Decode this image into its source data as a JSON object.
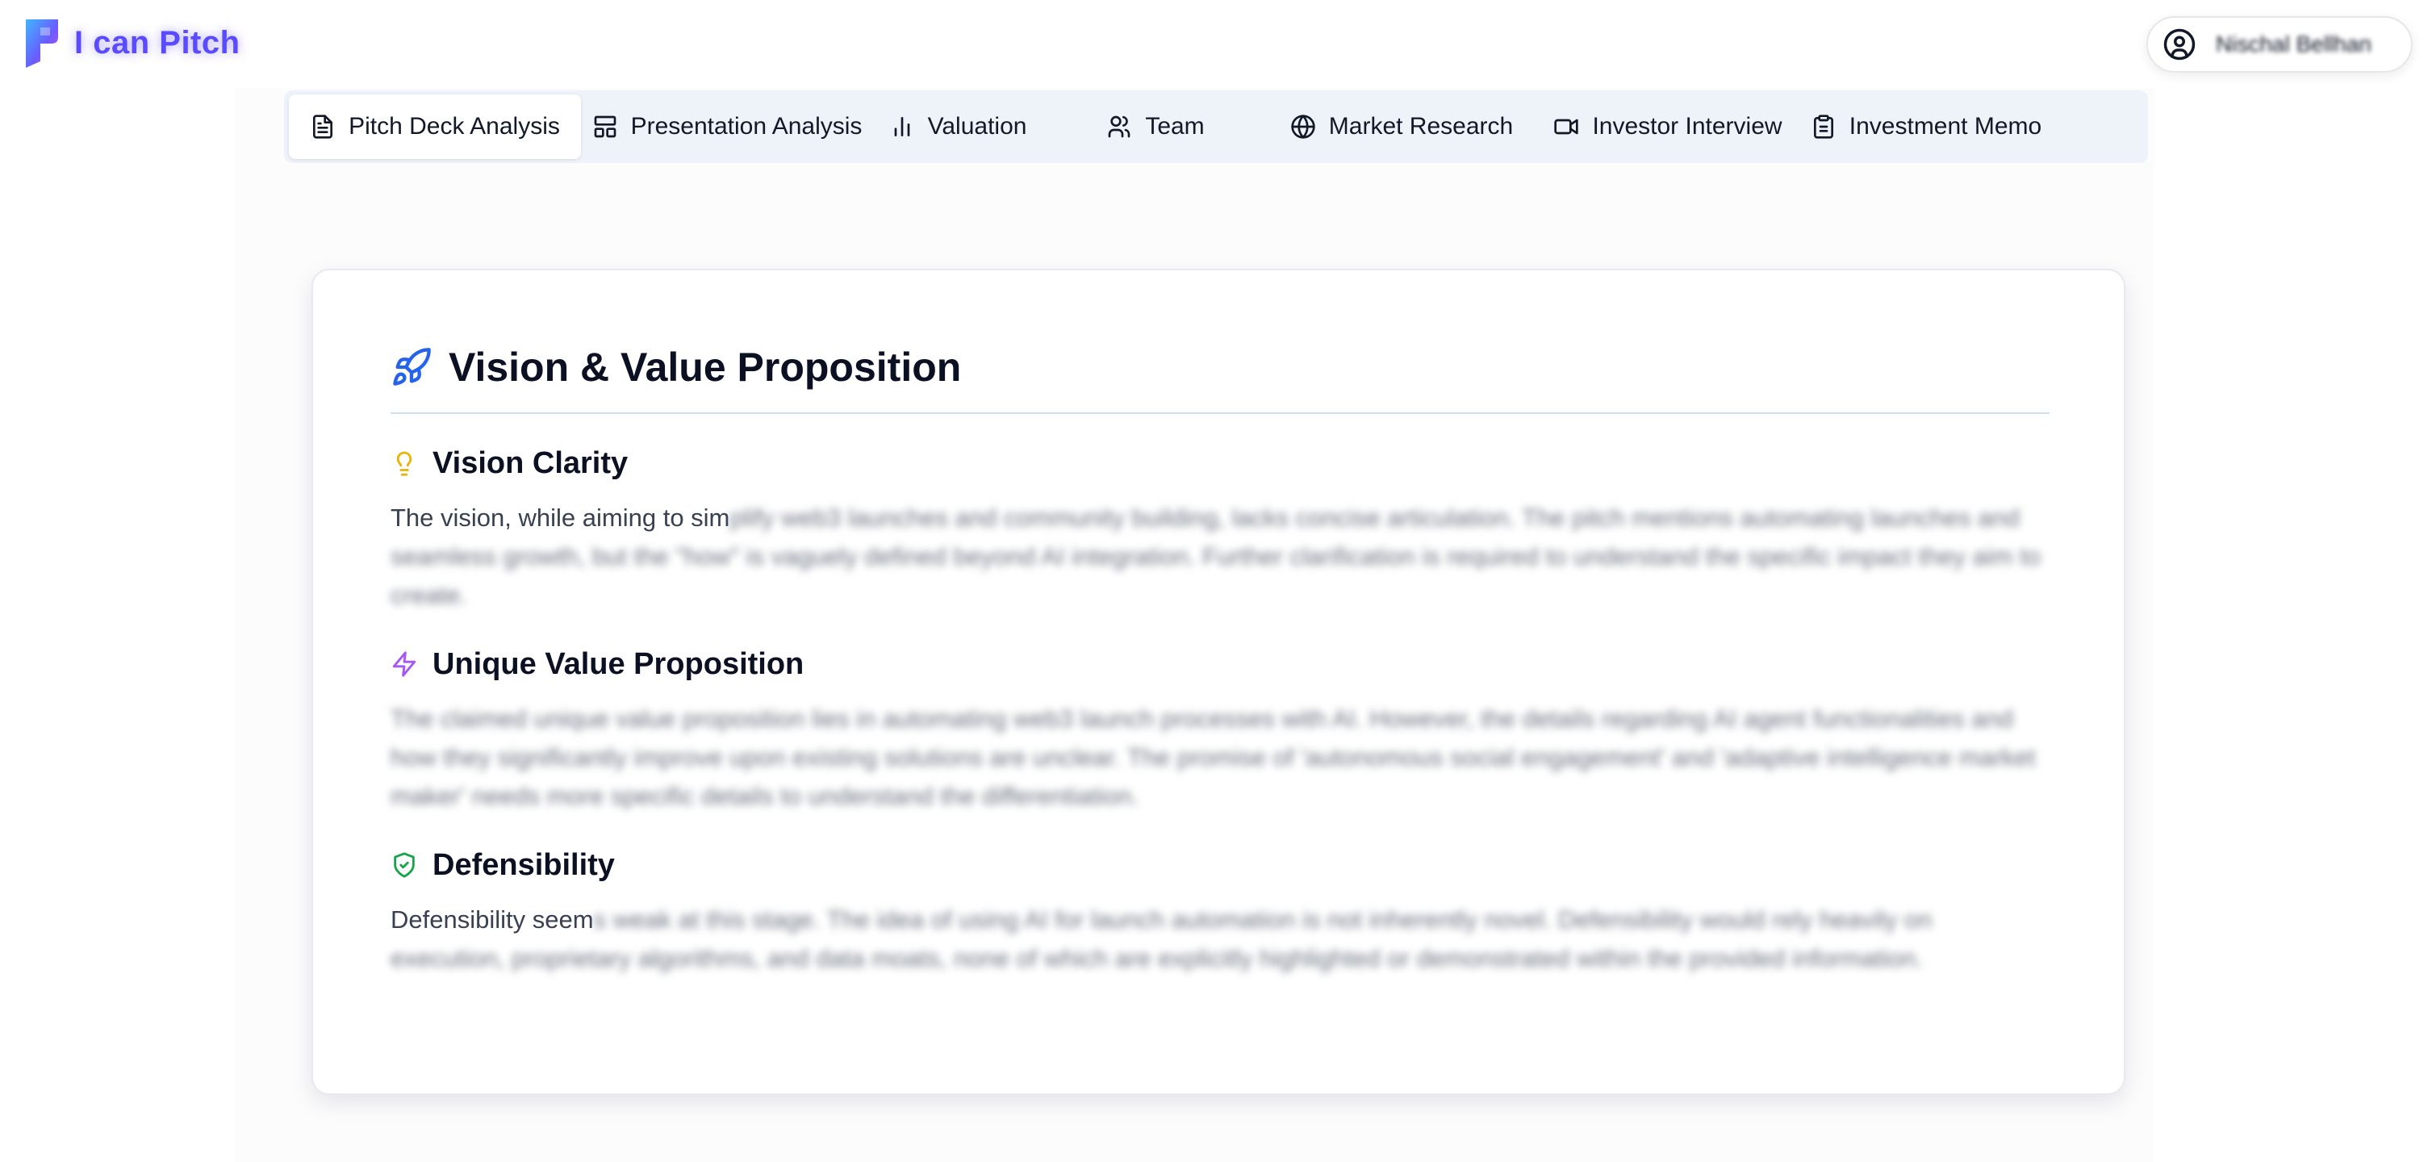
{
  "app": {
    "name": "I can Pitch",
    "brand_color": "#5b4bff"
  },
  "user": {
    "icon": "user-circle-icon",
    "name": "Nischal Bellhan"
  },
  "tabs": [
    {
      "label": "Pitch Deck Analysis",
      "icon": "file-text-icon",
      "active": true
    },
    {
      "label": "Presentation Analysis",
      "icon": "layout-icon",
      "active": false
    },
    {
      "label": "Valuation",
      "icon": "bar-chart-icon",
      "active": false
    },
    {
      "label": "Team",
      "icon": "users-icon",
      "active": false
    },
    {
      "label": "Market Research",
      "icon": "globe-icon",
      "active": false
    },
    {
      "label": "Investor Interview",
      "icon": "video-icon",
      "active": false
    },
    {
      "label": "Investment Memo",
      "icon": "clipboard-icon",
      "active": false
    }
  ],
  "card": {
    "title": "Vision & Value Proposition",
    "icon": "rocket-icon",
    "sections": [
      {
        "title": "Vision Clarity",
        "icon": "lightbulb-icon",
        "icon_color": "#eab308",
        "text_clear": "The vision, while aiming to sim",
        "text_blurred": "plify web3 launches and community building, lacks concise articulation. The pitch mentions automating launches and seamless growth, but the \"how\" is vaguely defined beyond AI integration. Further clarification is required to understand the specific impact they aim to create."
      },
      {
        "title": "Unique Value Proposition",
        "icon": "zap-icon",
        "icon_color": "#a855f7",
        "text_clear": "",
        "text_blurred": "The claimed unique value proposition lies in automating web3 launch processes with AI. However, the details regarding AI agent functionalities and how they significantly improve upon existing solutions are unclear. The promise of 'autonomous social engagement' and 'adaptive intelligence market maker' needs more specific details to understand the differentiation."
      },
      {
        "title": "Defensibility",
        "icon": "shield-check-icon",
        "icon_color": "#16a34a",
        "text_clear": "Defensibility seem",
        "text_blurred": "s weak at this stage. The idea of using AI for launch automation is not inherently novel. Defensibility would rely heavily on execution, proprietary algorithms, and data moats, none of which are explicitly highlighted or demonstrated within the provided information."
      }
    ]
  }
}
